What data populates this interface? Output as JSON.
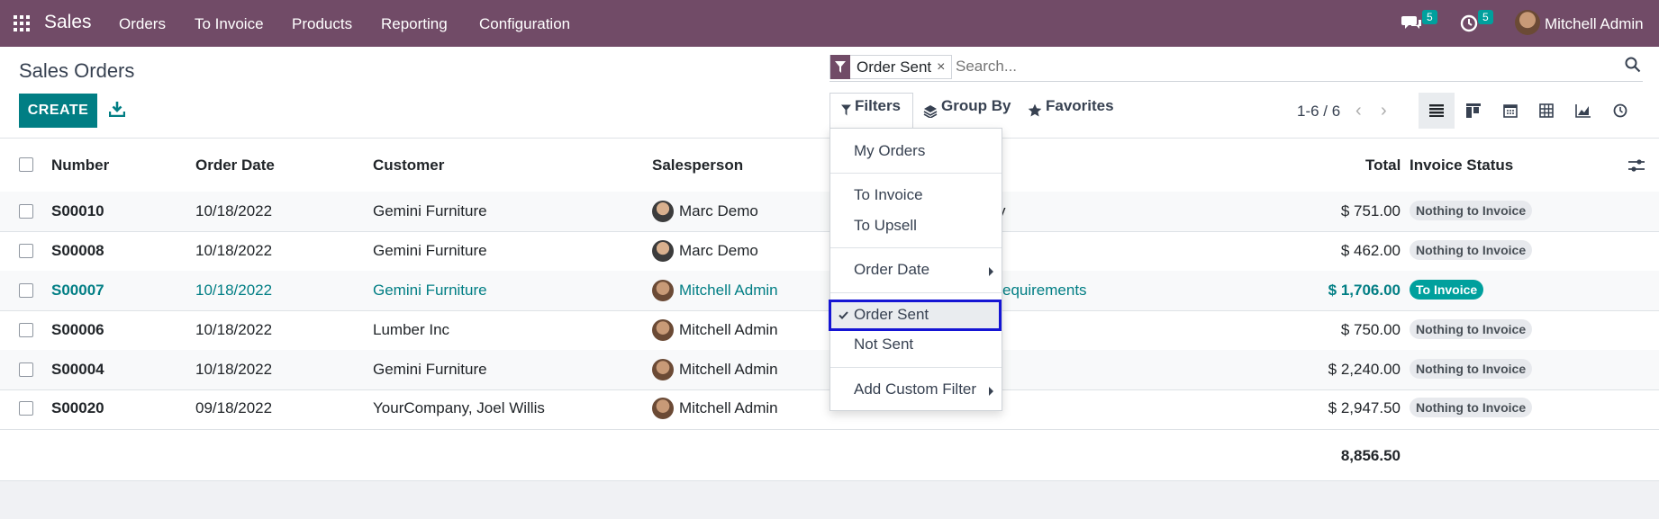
{
  "topbar": {
    "app_name": "Sales",
    "menu": [
      "Orders",
      "To Invoice",
      "Products",
      "Reporting",
      "Configuration"
    ],
    "messages_count": "5",
    "activities_count": "5",
    "user_name": "Mitchell Admin"
  },
  "page": {
    "title": "Sales Orders",
    "create_label": "CREATE"
  },
  "search": {
    "facet_value": "Order Sent",
    "facet_remove": "×",
    "placeholder": "Search..."
  },
  "toolbar": {
    "filters_label": "Filters",
    "groupby_label": "Group By",
    "favorites_label": "Favorites",
    "pager": "1-6 / 6"
  },
  "table": {
    "headers": {
      "number": "Number",
      "order_date": "Order Date",
      "customer": "Customer",
      "salesperson": "Salesperson",
      "total": "Total",
      "invoice_status": "Invoice Status"
    },
    "rows": [
      {
        "number": "S00010",
        "date": "10/18/2022",
        "customer": "Gemini Furniture",
        "salesperson": "Marc Demo",
        "extra": "y",
        "total": "$ 751.00",
        "status": "Nothing to Invoice"
      },
      {
        "number": "S00008",
        "date": "10/18/2022",
        "customer": "Gemini Furniture",
        "salesperson": "Marc Demo",
        "extra": "",
        "total": "$ 462.00",
        "status": "Nothing to Invoice"
      },
      {
        "number": "S00007",
        "date": "10/18/2022",
        "customer": "Gemini Furniture",
        "salesperson": "Mitchell Admin",
        "extra": "equirements",
        "total": "$ 1,706.00",
        "status": "To Invoice"
      },
      {
        "number": "S00006",
        "date": "10/18/2022",
        "customer": "Lumber Inc",
        "salesperson": "Mitchell Admin",
        "extra": "",
        "total": "$ 750.00",
        "status": "Nothing to Invoice"
      },
      {
        "number": "S00004",
        "date": "10/18/2022",
        "customer": "Gemini Furniture",
        "salesperson": "Mitchell Admin",
        "extra": "",
        "total": "$ 2,240.00",
        "status": "Nothing to Invoice"
      },
      {
        "number": "S00020",
        "date": "09/18/2022",
        "customer": "YourCompany, Joel Willis",
        "salesperson": "Mitchell Admin",
        "extra": "",
        "total": "$ 2,947.50",
        "status": "Nothing to Invoice"
      }
    ],
    "grand_total": "8,856.50"
  },
  "filters_menu": {
    "my_orders": "My Orders",
    "to_invoice": "To Invoice",
    "to_upsell": "To Upsell",
    "order_date": "Order Date",
    "order_sent": "Order Sent",
    "not_sent": "Not Sent",
    "add_custom_filter": "Add Custom Filter"
  },
  "colors": {
    "topbar": "#714b67",
    "accent": "#017e84",
    "badge": "#00a09d",
    "selection_outline": "#1515d4"
  }
}
